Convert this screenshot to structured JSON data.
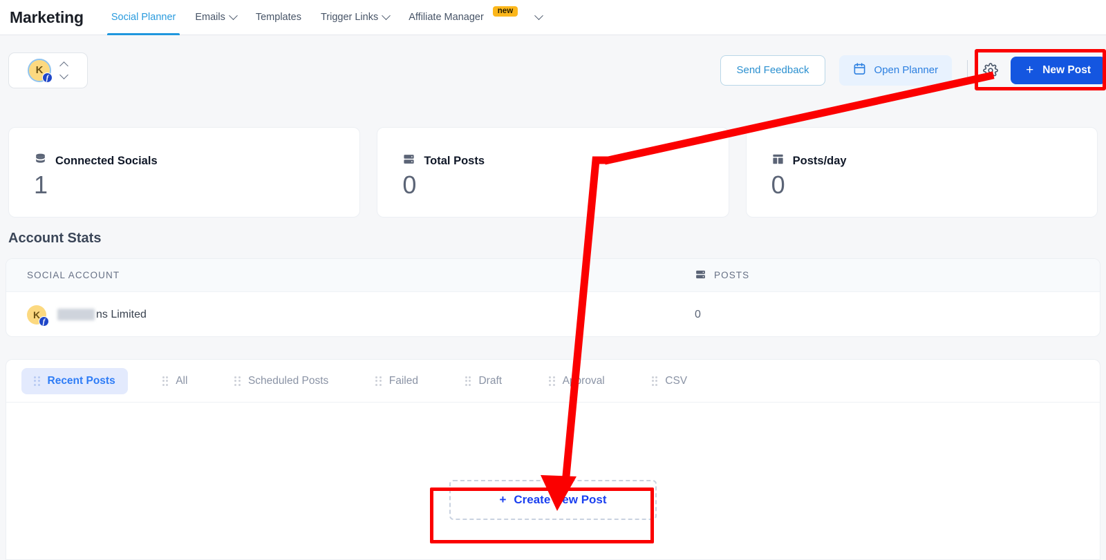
{
  "nav": {
    "brand": "Marketing",
    "items": [
      {
        "label": "Social Planner",
        "active": true,
        "caret": false,
        "badge": ""
      },
      {
        "label": "Emails",
        "active": false,
        "caret": true,
        "badge": ""
      },
      {
        "label": "Templates",
        "active": false,
        "caret": false,
        "badge": ""
      },
      {
        "label": "Trigger Links",
        "active": false,
        "caret": true,
        "badge": ""
      },
      {
        "label": "Affiliate Manager",
        "active": false,
        "caret": false,
        "badge": "new"
      }
    ]
  },
  "toolbar": {
    "account_initial": "K",
    "account_platform_badge": "f",
    "send_feedback_label": "Send Feedback",
    "open_planner_label": "Open Planner",
    "new_post_label": "New Post",
    "new_post_plus": "+",
    "settings_icon": "gear-icon",
    "calendar_icon": "calendar-icon"
  },
  "stats": [
    {
      "icon": "database-icon",
      "label": "Connected Socials",
      "value": "1"
    },
    {
      "icon": "server-icon",
      "label": "Total Posts",
      "value": "0"
    },
    {
      "icon": "dashboard-icon",
      "label": "Posts/day",
      "value": "0"
    }
  ],
  "account_stats": {
    "title": "Account Stats",
    "columns": {
      "social_account": "SOCIAL ACCOUNT",
      "posts": "POSTS"
    },
    "rows": [
      {
        "avatar_initial": "K",
        "platform_badge": "f",
        "name_visible_suffix": "ns Limited",
        "name_redacted": true,
        "posts": "0"
      }
    ]
  },
  "tabs": [
    {
      "label": "Recent Posts",
      "active": true
    },
    {
      "label": "All",
      "active": false
    },
    {
      "label": "Scheduled Posts",
      "active": false
    },
    {
      "label": "Failed",
      "active": false
    },
    {
      "label": "Draft",
      "active": false
    },
    {
      "label": "Approval",
      "active": false
    },
    {
      "label": "CSV",
      "active": false
    }
  ],
  "content": {
    "create_post_label": "Create New Post",
    "create_post_plus": "+"
  },
  "colors": {
    "accent_blue": "#1456e0",
    "link_blue": "#2e7cf6",
    "active_tab_bg": "#e3eafd",
    "nav_active": "#2a9bde",
    "page_bg": "#f6f7f9",
    "badge_new_bg": "#fcb71b",
    "annotation_red": "#fb0000",
    "avatar_bg": "#fcd980"
  }
}
